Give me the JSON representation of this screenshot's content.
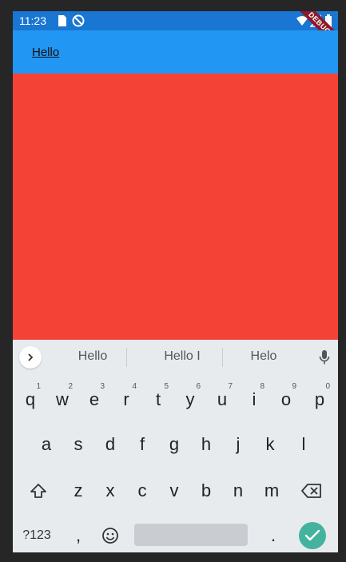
{
  "status_bar": {
    "time": "11:23",
    "icons": [
      "sd-card-icon",
      "no-sync-icon",
      "wifi-icon",
      "signal-icon",
      "battery-icon"
    ],
    "debug_banner": "DEBUG"
  },
  "app_bar": {
    "title": "Hello"
  },
  "colors": {
    "status_bar": "#1976d2",
    "app_bar": "#2196f3",
    "body": "#f44336",
    "keyboard": "#e8ebee",
    "enter_key": "#43b39e"
  },
  "keyboard": {
    "suggestions": [
      "Hello",
      "Hello I",
      "Helo"
    ],
    "row1": [
      {
        "ch": "q",
        "hint": "1"
      },
      {
        "ch": "w",
        "hint": "2"
      },
      {
        "ch": "e",
        "hint": "3"
      },
      {
        "ch": "r",
        "hint": "4"
      },
      {
        "ch": "t",
        "hint": "5"
      },
      {
        "ch": "y",
        "hint": "6"
      },
      {
        "ch": "u",
        "hint": "7"
      },
      {
        "ch": "i",
        "hint": "8"
      },
      {
        "ch": "o",
        "hint": "9"
      },
      {
        "ch": "p",
        "hint": "0"
      }
    ],
    "row2": [
      "a",
      "s",
      "d",
      "f",
      "g",
      "h",
      "j",
      "k",
      "l"
    ],
    "row3": [
      "z",
      "x",
      "c",
      "v",
      "b",
      "n",
      "m"
    ],
    "symbols_label": "?123",
    "comma": ",",
    "period": "."
  }
}
